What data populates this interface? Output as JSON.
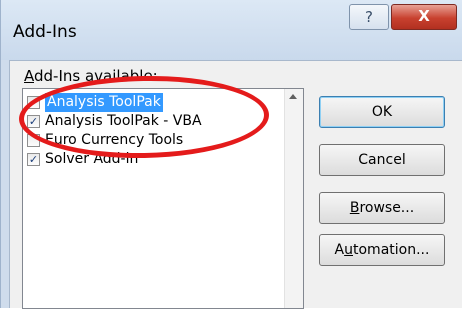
{
  "window": {
    "title": "Add-Ins",
    "help_glyph": "?",
    "close_glyph": "X"
  },
  "list": {
    "label_prefix": "",
    "label_mnemonic": "A",
    "label_rest": "dd-Ins available:",
    "items": [
      {
        "label": "Analysis ToolPak",
        "checked": true,
        "selected": true
      },
      {
        "label": "Analysis ToolPak - VBA",
        "checked": true,
        "selected": false
      },
      {
        "label": "Euro Currency Tools",
        "checked": false,
        "selected": false
      },
      {
        "label": "Solver Add-in",
        "checked": true,
        "selected": false
      }
    ],
    "check_glyph": "✓"
  },
  "buttons": {
    "ok": "OK",
    "cancel": "Cancel",
    "browse_mnemonic": "B",
    "browse_rest": "rowse...",
    "automation_pre": "A",
    "automation_mnemonic": "u",
    "automation_rest": "tomation..."
  },
  "colors": {
    "selection": "#3399ff",
    "annotation_ring": "#e41b1b"
  }
}
